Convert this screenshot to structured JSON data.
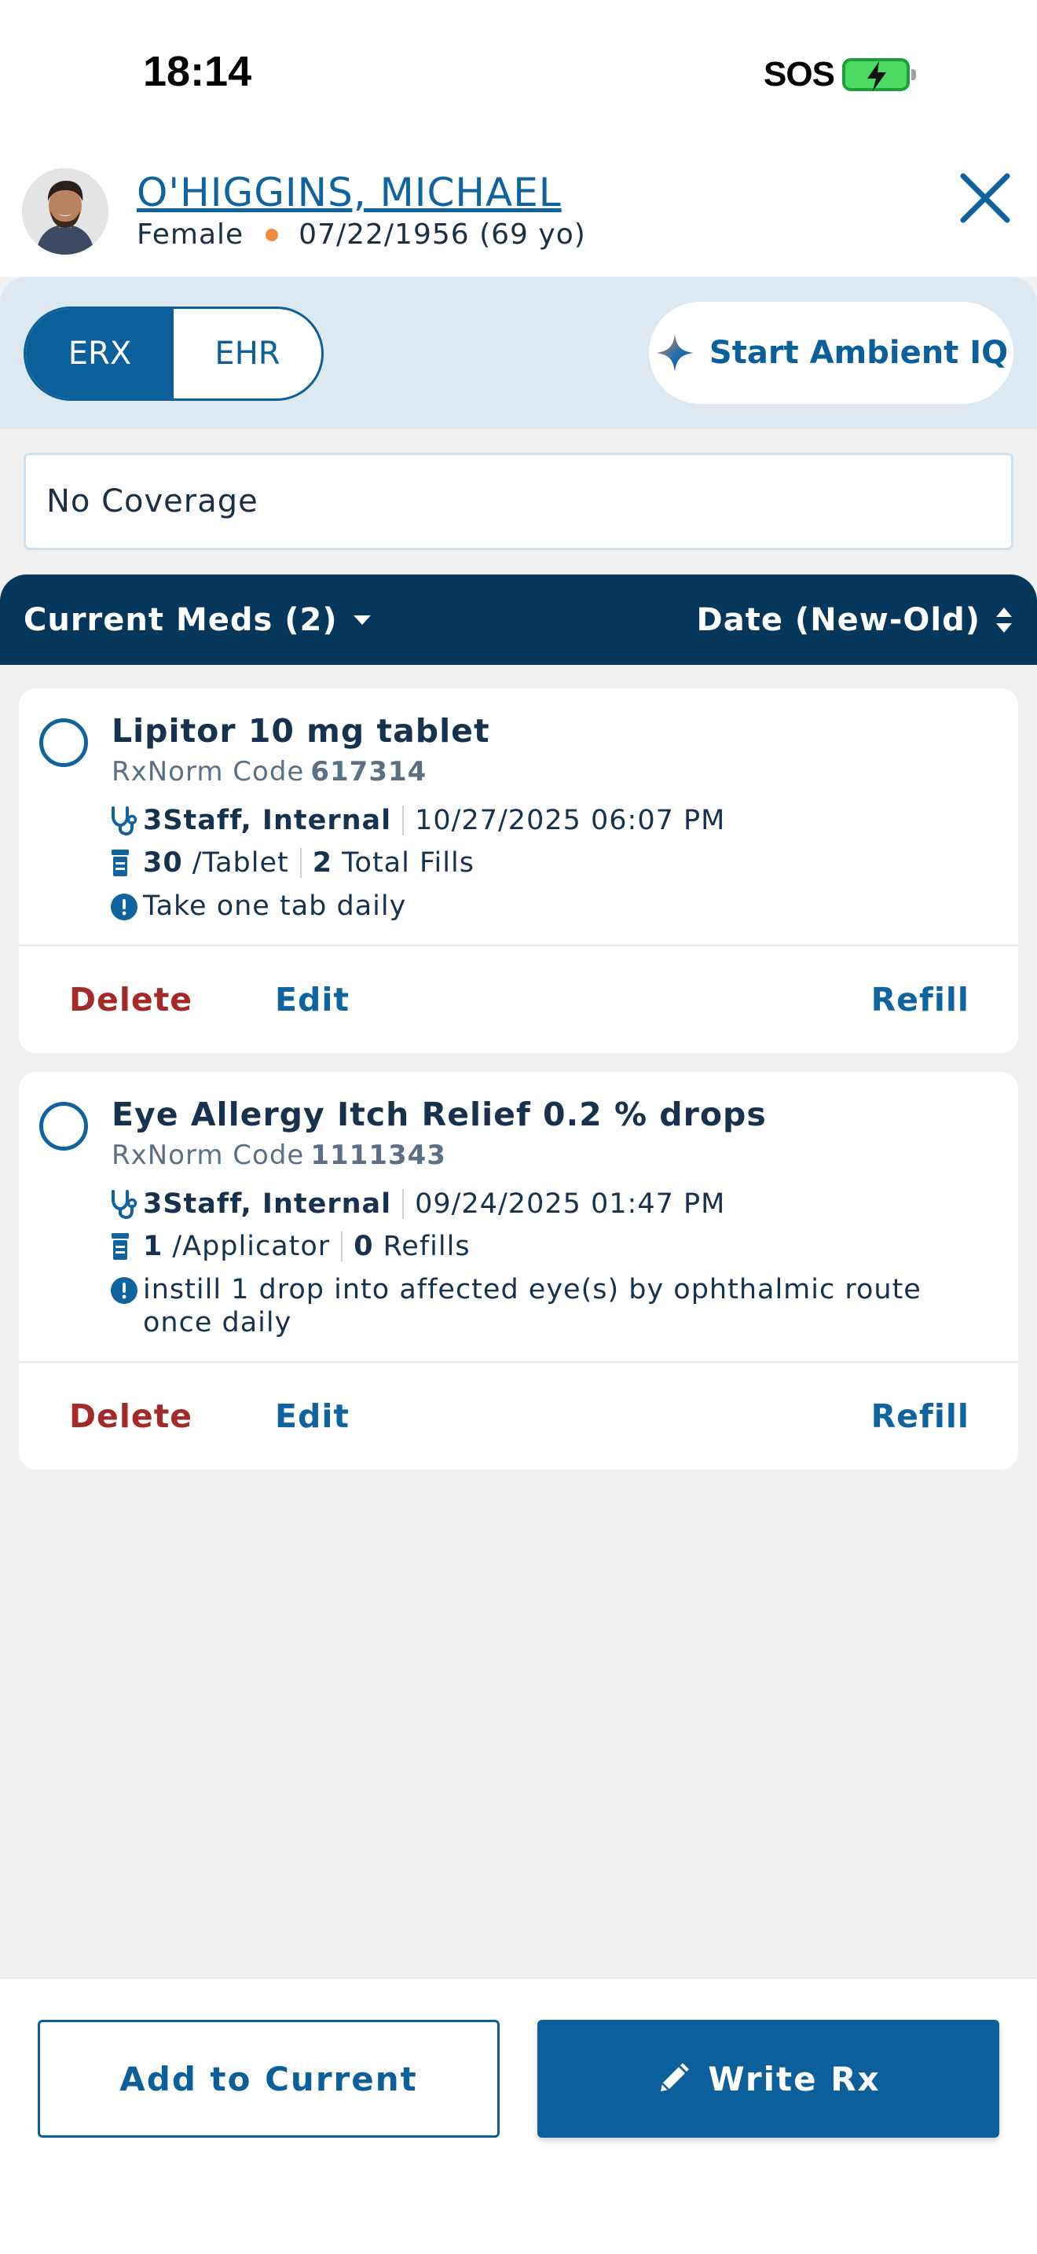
{
  "status_bar": {
    "time": "18:14",
    "sos": "SOS"
  },
  "patient": {
    "name": "O'HIGGINS, MICHAEL",
    "gender": "Female",
    "dob": "07/22/1956 (69 yo)"
  },
  "mode_toggle": {
    "options": [
      "ERX",
      "EHR"
    ],
    "selected": "ERX"
  },
  "ambient_button": {
    "label": "Start Ambient IQ",
    "icon": "sparkle-icon"
  },
  "coverage": {
    "text": "No Coverage"
  },
  "list_header": {
    "filter_label": "Current Meds (2)",
    "sort_label": "Date (New-Old)"
  },
  "meds": [
    {
      "name": "Lipitor 10 mg tablet",
      "rxnorm_label": "RxNorm Code",
      "rxnorm_code": "617314",
      "prescriber": "3Staff, Internal",
      "datetime": "10/27/2025 06:07 PM",
      "quantity": "30",
      "unit": "/Tablet",
      "fills_count": "2",
      "fills_label": "Total Fills",
      "instructions": "Take one tab daily",
      "actions": {
        "delete": "Delete",
        "edit": "Edit",
        "refill": "Refill"
      }
    },
    {
      "name": "Eye Allergy Itch Relief 0.2 % drops",
      "rxnorm_label": "RxNorm Code",
      "rxnorm_code": "1111343",
      "prescriber": "3Staff, Internal",
      "datetime": "09/24/2025 01:47 PM",
      "quantity": "1",
      "unit": "/Applicator",
      "fills_count": "0",
      "fills_label": "Refills",
      "instructions": "instill 1 drop into affected eye(s) by ophthalmic route once daily",
      "actions": {
        "delete": "Delete",
        "edit": "Edit",
        "refill": "Refill"
      }
    }
  ],
  "bottom_actions": {
    "add_label": "Add to Current",
    "write_label": "Write Rx"
  },
  "colors": {
    "primary": "#0b5f9b",
    "header_dark": "#05375c",
    "danger": "#a42a2a",
    "accent_dot": "#f08a3c"
  }
}
